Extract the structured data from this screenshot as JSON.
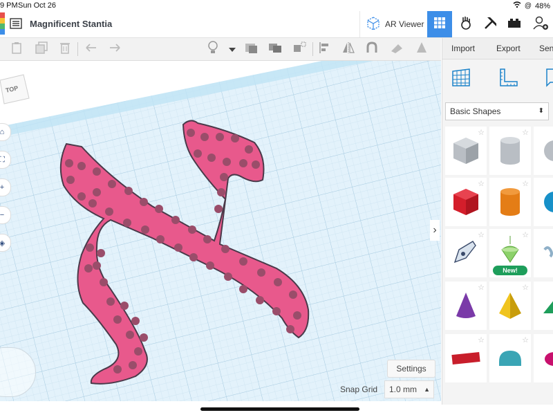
{
  "statusbar": {
    "time": "9 PM",
    "date": "Sun Oct 26",
    "battery": "48%"
  },
  "header": {
    "title": "Magnificent Stantia",
    "ar_viewer": "AR Viewer"
  },
  "sidepanel": {
    "import": "Import",
    "export": "Export",
    "send": "Send",
    "dropdown": "Basic Shapes",
    "new_badge": "New!",
    "shapes": [
      "box",
      "cylinder",
      "sphere",
      "box-red",
      "cylinder-orange",
      "sphere-blue",
      "pen-icon-shape",
      "spinning-top",
      "text-shape",
      "cone",
      "pyramid",
      "wedge",
      "text-3d",
      "half-cylinder",
      "torus"
    ]
  },
  "workplane": {
    "viewcube_label": "TOP",
    "settings": "Settings",
    "snap_grid_label": "Snap Grid",
    "snap_grid_value": "1.0 mm"
  },
  "colors": {
    "accent": "#3d8ee8",
    "shape_pink": "#e8598c",
    "grid_bg": "#d9eef8"
  }
}
